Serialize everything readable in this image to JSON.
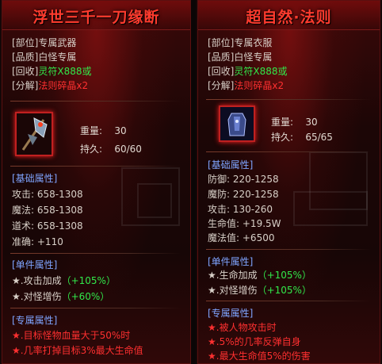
{
  "left": {
    "title": "浮世三千一刀缘断",
    "slot": "[部位]专属武器",
    "quality": "[品质]白怪专属",
    "recycle_prefix": "[回收]",
    "recycle_value": "灵符X888或",
    "dismantle_prefix": "[分解]",
    "dismantle_value": "法则碎晶x2",
    "weight_label": "重量:",
    "weight_value": "30",
    "durability_label": "持久:",
    "durability_value": "60/60",
    "base_title": "[基础属性]",
    "base_stats": [
      {
        "label": "攻击:",
        "value": "658-1308"
      },
      {
        "label": "魔法:",
        "value": "658-1308"
      },
      {
        "label": "道术:",
        "value": "658-1308"
      },
      {
        "label": "准确:",
        "value": "+110"
      }
    ],
    "unit_title": "[单件属性]",
    "unit_stats": [
      {
        "label": "★.攻击加成",
        "value": "（+105%）"
      },
      {
        "label": "★.对怪增伤",
        "value": "（+60%）"
      }
    ],
    "special_title": "[专属属性]",
    "special_stats": [
      "★.目标怪物血量大于50%时",
      "★.几率打掉目标3%最大生命值"
    ]
  },
  "right": {
    "title": "超自然·法则",
    "slot": "[部位]专属衣服",
    "quality": "[品质]白怪专属",
    "recycle_prefix": "[回收]",
    "recycle_value": "灵符X888或",
    "dismantle_prefix": "[分解]",
    "dismantle_value": "法则碎晶x2",
    "weight_label": "重量:",
    "weight_value": "30",
    "durability_label": "持久:",
    "durability_value": "65/65",
    "base_title": "[基础属性]",
    "base_stats": [
      {
        "label": "防御:",
        "value": "220-1258"
      },
      {
        "label": "魔防:",
        "value": "220-1258"
      },
      {
        "label": "攻击:",
        "value": "130-260"
      },
      {
        "label": "生命值:",
        "value": "+19.5W"
      },
      {
        "label": "魔法值:",
        "value": "+6500"
      }
    ],
    "unit_title": "[单件属性]",
    "unit_stats": [
      {
        "label": "★.生命加成",
        "value": "（+105%）"
      },
      {
        "label": "★.对怪增伤",
        "value": "（+105%）"
      }
    ],
    "special_title": "[专属属性]",
    "special_stats": [
      "★.被人物攻击时",
      "★.5%的几率反弹自身",
      "★.最大生命值5%的伤害"
    ]
  },
  "colors": {
    "title": "#ff3b2e",
    "green": "#31e84a",
    "red": "#ff3030",
    "section": "#7fa4ff"
  },
  "icons": {
    "left_item": "axe-weapon-icon",
    "right_item": "armor-clothing-icon"
  }
}
